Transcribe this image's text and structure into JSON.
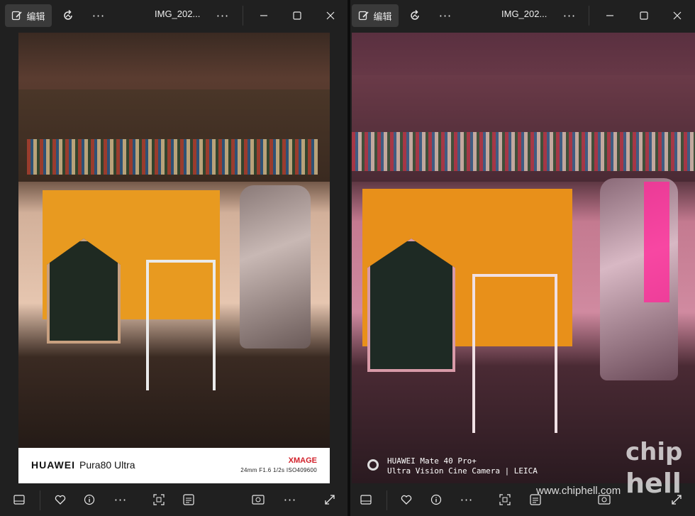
{
  "windows": [
    {
      "edit_label": "编辑",
      "filename": "IMG_202...",
      "photo": {
        "brand": "HUAWEI",
        "model": "Pura80 Ultra",
        "xmage_x": "X",
        "xmage_rest": "MAGE",
        "specs": "24mm  F1.6  1/2s  ISO409600"
      }
    },
    {
      "edit_label": "编辑",
      "filename": "IMG_202...",
      "photo": {
        "watermark_line1": "HUAWEI Mate 40 Pro+",
        "watermark_line2": "Ultra Vision Cine Camera | LEICA"
      }
    }
  ],
  "icons": {
    "edit": "edit-icon",
    "rotate": "rotate-icon",
    "more": "more-icon",
    "minimize": "minimize-icon",
    "maximize": "maximize-icon",
    "close": "close-icon",
    "filmstrip": "filmstrip-icon",
    "favorite": "heart-icon",
    "info": "info-icon",
    "crop": "crop-icon",
    "text": "text-extract-icon",
    "image": "image-icon",
    "expand": "expand-icon"
  },
  "site_watermark": "www.chiphell.com",
  "logo_watermark": "chip hell"
}
